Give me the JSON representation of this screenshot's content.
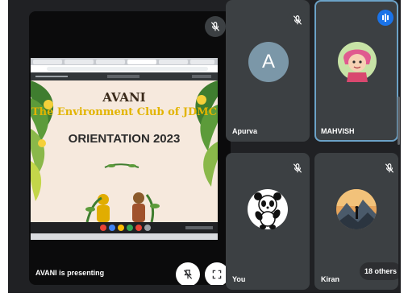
{
  "stage": {
    "presenting_label": "AVANI is presenting",
    "slide": {
      "title": "AVANI",
      "subtitle": "The Environment Club of JDMC",
      "event": "ORIENTATION 2023"
    }
  },
  "participants": [
    {
      "name": "Apurva",
      "avatar_letter": "A",
      "avatar_color": "#7b97a8",
      "muted": true
    },
    {
      "name": "MAHVISH",
      "avatar": "cartoon-girl",
      "speaking": true
    },
    {
      "name": "You",
      "avatar": "panda",
      "muted": true
    },
    {
      "name": "Kiran",
      "avatar": "mountain-landscape",
      "muted": true
    }
  ],
  "overflow": {
    "label": "18 others"
  },
  "colors": {
    "meet_bg": "#202124",
    "tile_bg": "#3c4043",
    "speaking_border": "#6ba2c7",
    "speaking_badge": "#1a73e8",
    "slide_bg": "#f6e9dd",
    "slide_title_color": "#3a2a1a",
    "slide_subtitle_color": "#e2b400"
  }
}
